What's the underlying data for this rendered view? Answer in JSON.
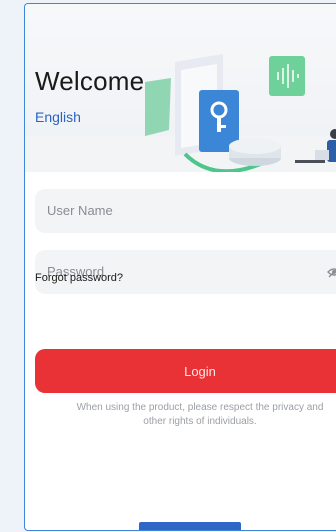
{
  "hero": {
    "title": "Welcome",
    "language": "English"
  },
  "form": {
    "username_placeholder": "User Name",
    "password_placeholder": "Password",
    "password_toggle_icon": "eye-off-icon",
    "forgot_label": "Forgot password?",
    "login_label": "Login"
  },
  "notice": {
    "line1": "When using the product, please respect the privacy and",
    "line2": "other rights of individuals."
  },
  "colors": {
    "accent_red": "#e83236",
    "link_blue": "#2b63c2",
    "frame_blue": "#3f86d9"
  }
}
